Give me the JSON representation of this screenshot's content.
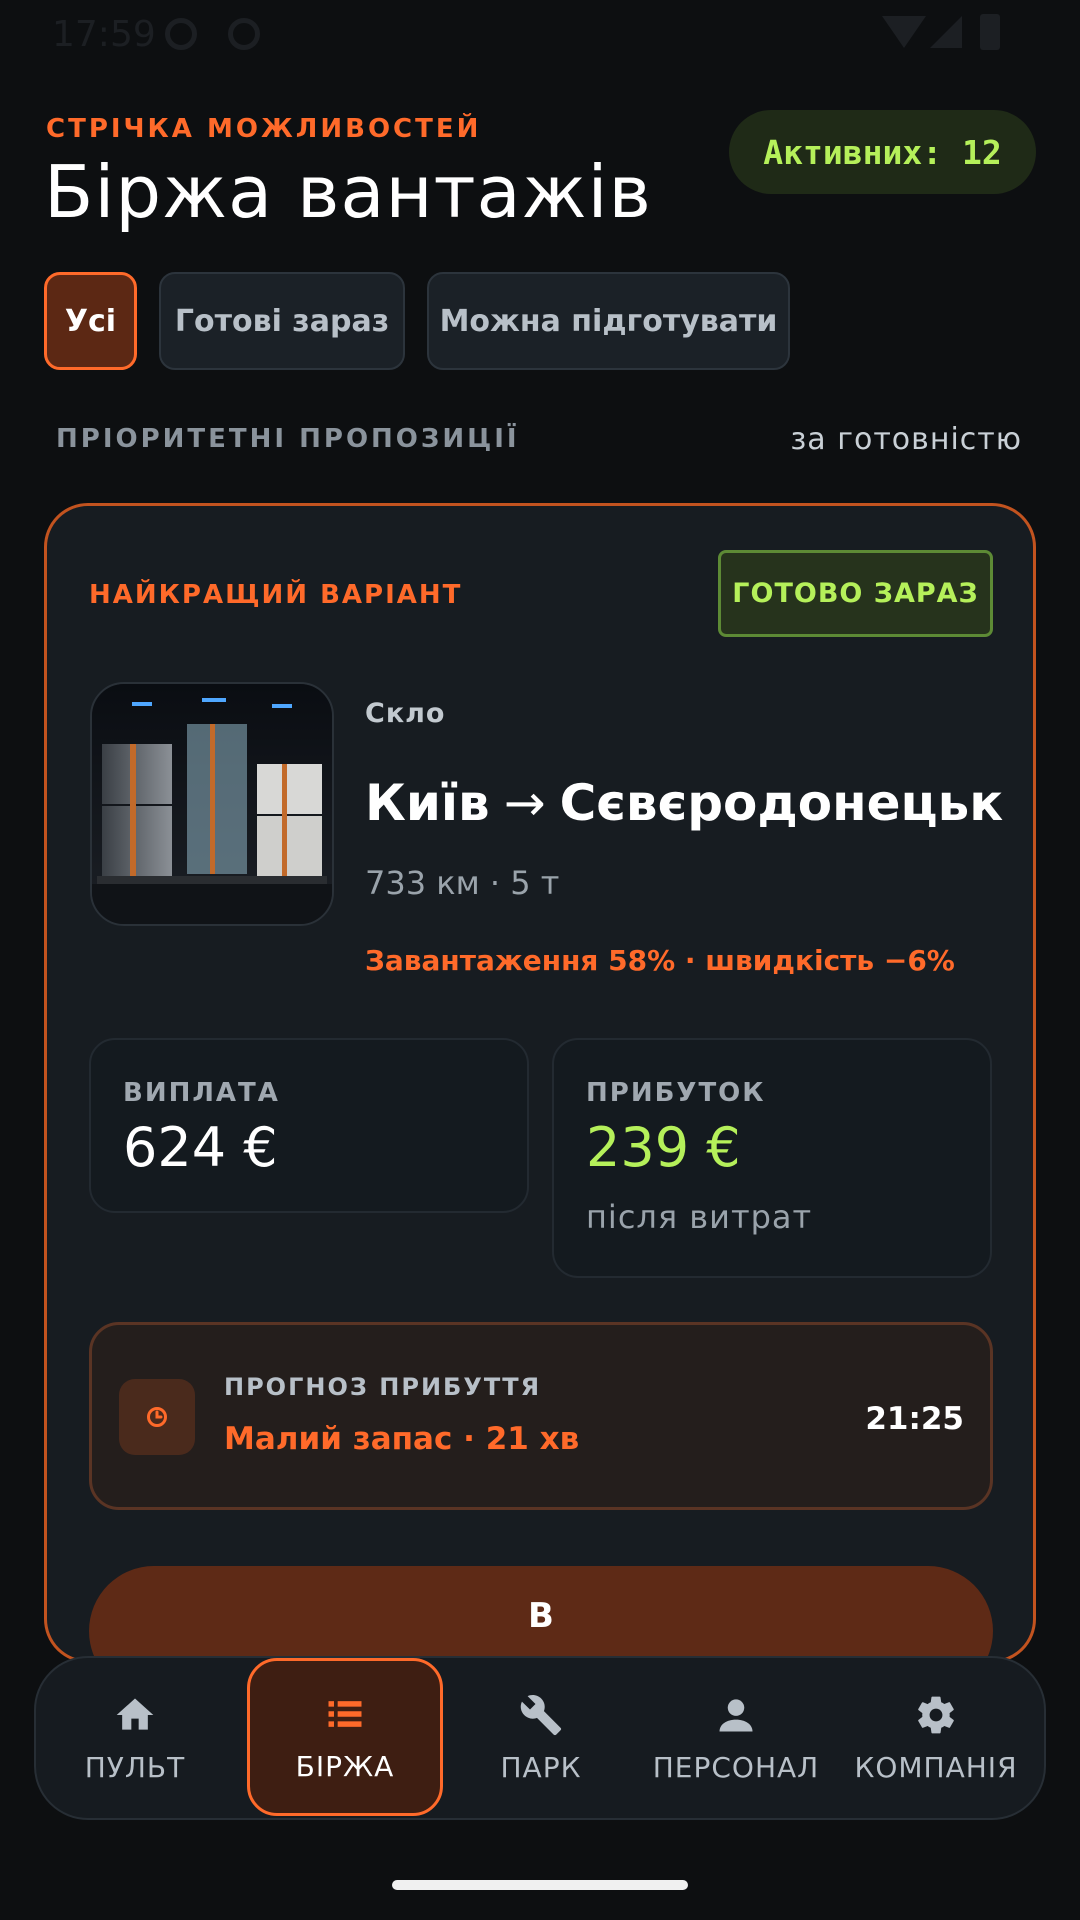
{
  "status_bar": {
    "time": "17:59"
  },
  "header": {
    "eyebrow": "СТРІЧКА МОЖЛИВОСТЕЙ",
    "title": "Біржа вантажів",
    "active_count": "Активних: 12"
  },
  "filters": [
    {
      "label": "Усі",
      "active": true
    },
    {
      "label": "Готові зараз",
      "active": false
    },
    {
      "label": "Можна підготувати",
      "active": false
    }
  ],
  "section": {
    "label": "ПРІОРИТЕТНІ ПРОПОЗИЦІЇ",
    "sort": "за готовністю"
  },
  "offer": {
    "tag": "НАЙКРАЩИЙ ВАРІАНТ",
    "ready_badge": "ГОТОВО ЗАРАЗ",
    "cargo_type": "Скло",
    "origin": "Київ",
    "arrow": "→",
    "destination": "Сєвєродонецьк",
    "meta": "733 км · 5 т",
    "load_info": "Завантаження 58% · швидкість −6%",
    "payout": {
      "label": "ВИПЛАТА",
      "value": "624 €"
    },
    "profit": {
      "label": "ПРИБУТОК",
      "value": "239 €",
      "sub": "після витрат"
    },
    "eta": {
      "label": "ПРОГНОЗ ПРИБУТТЯ",
      "status": "Малий запас · 21 хв",
      "time": "21:25",
      "icon": "clock-icon"
    },
    "action_label": "В"
  },
  "nav": [
    {
      "label": "ПУЛЬТ",
      "icon": "home-icon",
      "active": false
    },
    {
      "label": "БІРЖА",
      "icon": "list-icon",
      "active": true
    },
    {
      "label": "ПАРК",
      "icon": "wrench-icon",
      "active": false
    },
    {
      "label": "ПЕРСОНАЛ",
      "icon": "person-icon",
      "active": false
    },
    {
      "label": "КОМПАНІЯ",
      "icon": "gear-icon",
      "active": false
    }
  ],
  "colors": {
    "accent": "#ff6a2a",
    "success": "#b5f05a",
    "background": "#0d0f11",
    "card": "#171c21"
  }
}
